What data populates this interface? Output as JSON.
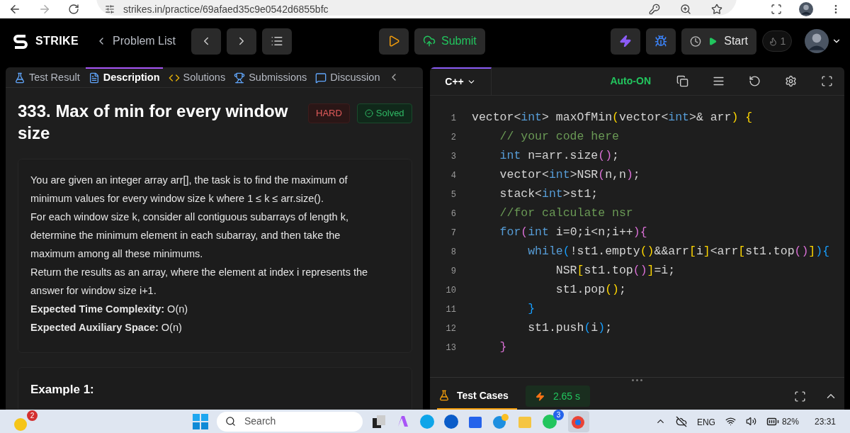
{
  "browser": {
    "url": "strikes.in/practice/69afaed35c9e0542d6855bfc"
  },
  "header": {
    "logo": "STRIKE",
    "back_link": "Problem List",
    "submit": "Submit",
    "start": "Start",
    "streak": "1"
  },
  "left_tabs": [
    {
      "label": "Test Result",
      "selected": false
    },
    {
      "label": "Description",
      "selected": true
    },
    {
      "label": "Solutions",
      "selected": false
    },
    {
      "label": "Submissions",
      "selected": false
    },
    {
      "label": "Discussion",
      "selected": false
    }
  ],
  "problem": {
    "title": "333. Max of min for every window size",
    "difficulty": "HARD",
    "status": "Solved",
    "paragraphs": [
      "You are given an integer array arr[], the task is to find the maximum of minimum values for every window size k where 1 ≤ k ≤ arr.size().",
      "For each window size k, consider all contiguous subarrays of length k, determine the minimum element in each subarray, and then take the maximum among all these minimums.",
      "Return the results as an array, where the element at index i represents the answer for window size i+1."
    ],
    "complexity": [
      {
        "label": "Expected Time Complexity:",
        "value": "O(n)"
      },
      {
        "label": "Expected Auxiliary Space:",
        "value": "O(n)"
      }
    ],
    "example_title": "Example 1:"
  },
  "editor": {
    "language": "C++",
    "autocomplete": "Auto-ON",
    "lines": [
      {
        "number": "1",
        "tokens": [
          {
            "kind": "text",
            "text": "vector<"
          },
          {
            "kind": "keyword",
            "text": "int"
          },
          {
            "kind": "text",
            "text": "> maxOfMin"
          },
          {
            "kind": "bracket1",
            "text": "("
          },
          {
            "kind": "text",
            "text": "vector<"
          },
          {
            "kind": "keyword",
            "text": "int"
          },
          {
            "kind": "text",
            "text": ">& arr"
          },
          {
            "kind": "bracket1",
            "text": ")"
          },
          {
            "kind": "bracket1",
            "text": " {"
          }
        ]
      },
      {
        "number": "2",
        "tokens": [
          {
            "kind": "comment",
            "text": "    // your code here"
          }
        ]
      },
      {
        "number": "3",
        "tokens": [
          {
            "kind": "keyword",
            "text": "    int"
          },
          {
            "kind": "text",
            "text": " n=arr.size"
          },
          {
            "kind": "bracket2",
            "text": "()"
          },
          {
            "kind": "text",
            "text": ";"
          }
        ]
      },
      {
        "number": "4",
        "tokens": [
          {
            "kind": "text",
            "text": "    vector<"
          },
          {
            "kind": "keyword",
            "text": "int"
          },
          {
            "kind": "text",
            "text": ">NSR"
          },
          {
            "kind": "bracket2",
            "text": "("
          },
          {
            "kind": "text",
            "text": "n,n"
          },
          {
            "kind": "bracket2",
            "text": ")"
          },
          {
            "kind": "text",
            "text": ";"
          }
        ]
      },
      {
        "number": "5",
        "tokens": [
          {
            "kind": "text",
            "text": "    stack<"
          },
          {
            "kind": "keyword",
            "text": "int"
          },
          {
            "kind": "text",
            "text": ">st1;"
          }
        ]
      },
      {
        "number": "6",
        "tokens": [
          {
            "kind": "comment",
            "text": "    //for calculate nsr"
          }
        ]
      },
      {
        "number": "7",
        "tokens": [
          {
            "kind": "keyword",
            "text": "    for"
          },
          {
            "kind": "bracket2",
            "text": "("
          },
          {
            "kind": "keyword",
            "text": "int"
          },
          {
            "kind": "text",
            "text": " i=0;i<n;i++"
          },
          {
            "kind": "bracket2",
            "text": ")"
          },
          {
            "kind": "bracket2",
            "text": "{"
          }
        ]
      },
      {
        "number": "8",
        "tokens": [
          {
            "kind": "keyword",
            "text": "        while"
          },
          {
            "kind": "bracket3",
            "text": "("
          },
          {
            "kind": "text",
            "text": "!st1.empty"
          },
          {
            "kind": "bracket1",
            "text": "()"
          },
          {
            "kind": "text",
            "text": "&&arr"
          },
          {
            "kind": "bracket1",
            "text": "["
          },
          {
            "kind": "text",
            "text": "i"
          },
          {
            "kind": "bracket1",
            "text": "]"
          },
          {
            "kind": "text",
            "text": "<arr"
          },
          {
            "kind": "bracket1",
            "text": "["
          },
          {
            "kind": "text",
            "text": "st1.top"
          },
          {
            "kind": "bracket2",
            "text": "()"
          },
          {
            "kind": "bracket1",
            "text": "]"
          },
          {
            "kind": "bracket3",
            "text": ")"
          },
          {
            "kind": "bracket3",
            "text": "{"
          }
        ]
      },
      {
        "number": "9",
        "tokens": [
          {
            "kind": "text",
            "text": "            NSR"
          },
          {
            "kind": "bracket1",
            "text": "["
          },
          {
            "kind": "text",
            "text": "st1.top"
          },
          {
            "kind": "bracket2",
            "text": "()"
          },
          {
            "kind": "bracket1",
            "text": "]"
          },
          {
            "kind": "text",
            "text": "=i;"
          }
        ]
      },
      {
        "number": "10",
        "tokens": [
          {
            "kind": "text",
            "text": "            st1.pop"
          },
          {
            "kind": "bracket1",
            "text": "()"
          },
          {
            "kind": "text",
            "text": ";"
          }
        ]
      },
      {
        "number": "11",
        "tokens": [
          {
            "kind": "bracket3",
            "text": "        }"
          }
        ]
      },
      {
        "number": "12",
        "tokens": [
          {
            "kind": "text",
            "text": "        st1.push"
          },
          {
            "kind": "bracket3",
            "text": "("
          },
          {
            "kind": "text",
            "text": "i"
          },
          {
            "kind": "bracket3",
            "text": ")"
          },
          {
            "kind": "text",
            "text": ";"
          }
        ]
      },
      {
        "number": "13",
        "tokens": [
          {
            "kind": "bracket2",
            "text": "    }"
          }
        ]
      }
    ]
  },
  "console": {
    "tab": "Test Cases",
    "runtime": "2.65 s"
  },
  "taskbar": {
    "widget_badge": "2",
    "search_placeholder": "Search",
    "chat_badge": "3",
    "language": "ENG",
    "battery": "82%",
    "time": "23:31"
  }
}
